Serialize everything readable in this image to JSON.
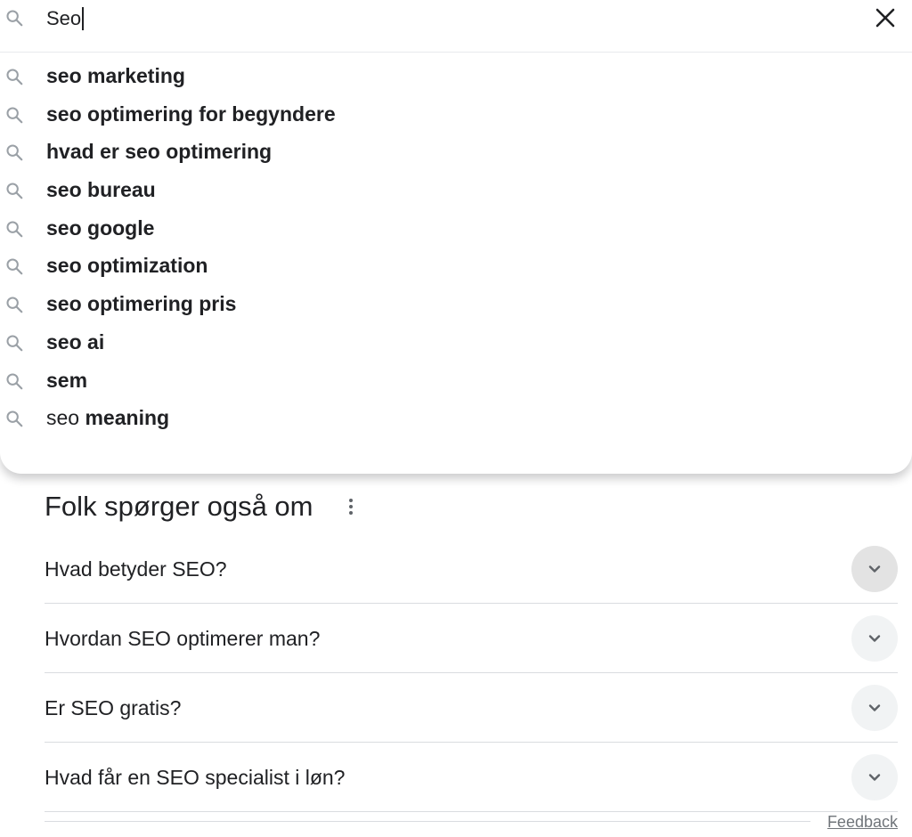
{
  "search": {
    "query": "Seo",
    "search_icon": "search-icon",
    "clear_icon": "close-icon"
  },
  "suggestions": [
    {
      "prefix": "",
      "completion": "seo marketing"
    },
    {
      "prefix": "",
      "completion": "seo optimering for begyndere"
    },
    {
      "prefix": "",
      "completion": "hvad er seo optimering"
    },
    {
      "prefix": "",
      "completion": "seo bureau"
    },
    {
      "prefix": "",
      "completion": "seo google"
    },
    {
      "prefix": "",
      "completion": "seo optimization"
    },
    {
      "prefix": "",
      "completion": "seo optimering pris"
    },
    {
      "prefix": "",
      "completion": "seo ai"
    },
    {
      "prefix": "",
      "completion": "sem"
    },
    {
      "prefix": "seo ",
      "completion": "meaning"
    }
  ],
  "paa": {
    "title": "Folk spørger også om",
    "menu_icon": "more-vert-icon",
    "questions": [
      {
        "text": "Hvad betyder SEO?"
      },
      {
        "text": "Hvordan SEO optimerer man?"
      },
      {
        "text": "Er SEO gratis?"
      },
      {
        "text": "Hvad får en SEO specialist i løn?"
      }
    ],
    "chevron_icon": "chevron-down-icon",
    "feedback_label": "Feedback"
  },
  "colors": {
    "text": "#202124",
    "icon": "#9aa0a6",
    "divider": "#dadce0",
    "chevron_bg": "#f1f3f4",
    "feedback": "#70757a"
  }
}
